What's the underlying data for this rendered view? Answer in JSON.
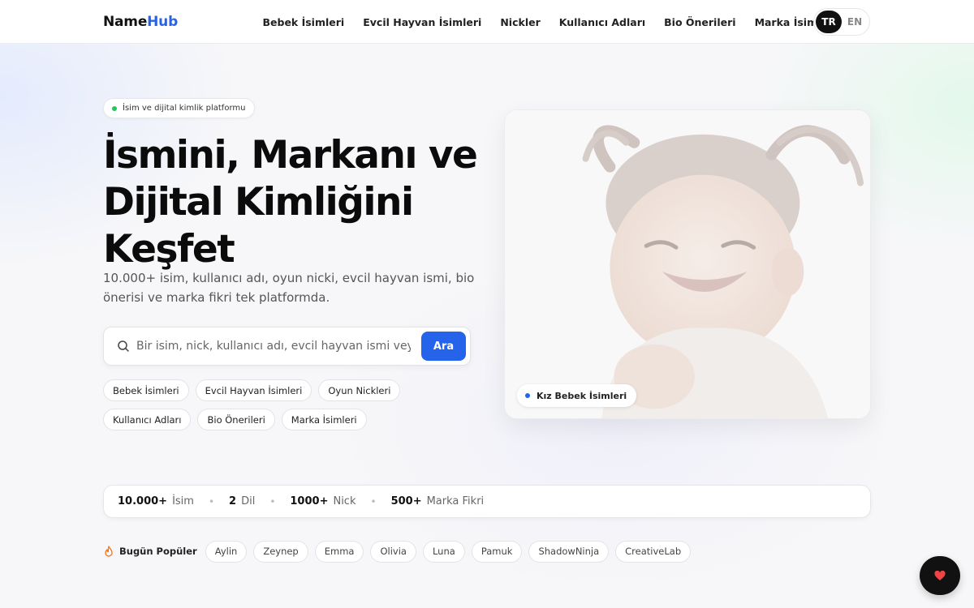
{
  "brand": {
    "name_part1": "Name",
    "name_part2": "Hub",
    "accent": "#2563eb"
  },
  "nav": {
    "items": [
      {
        "label": "Bebek İsimleri"
      },
      {
        "label": "Evcil Hayvan İsimleri"
      },
      {
        "label": "Nickler"
      },
      {
        "label": "Kullanıcı Adları"
      },
      {
        "label": "Bio Önerileri"
      },
      {
        "label": "Marka İsimleri"
      }
    ]
  },
  "lang": {
    "active": "TR",
    "other": "EN"
  },
  "hero": {
    "tag": "İsim ve dijital kimlik platformu",
    "title": "İsmini, Markanı ve Dijital Kimliğini Keşfet",
    "subtitle": "10.000+ isim, kullanıcı adı, oyun nicki, evcil hayvan ismi, bio önerisi ve marka fikri tek platformda."
  },
  "search": {
    "placeholder": "Bir isim, nick, kullanıcı adı, evcil hayvan ismi veya marka ara...",
    "button": "Ara"
  },
  "categories": [
    {
      "label": "Bebek İsimleri"
    },
    {
      "label": "Evcil Hayvan İsimleri"
    },
    {
      "label": "Oyun Nickleri"
    },
    {
      "label": "Kullanıcı Adları"
    },
    {
      "label": "Bio Önerileri"
    },
    {
      "label": "Marka İsimleri"
    }
  ],
  "hero_card": {
    "label": "Kız Bebek İsimleri",
    "image": "smiling-baby-girl-photo"
  },
  "stats": [
    {
      "num": "10.000+",
      "label": "İsim"
    },
    {
      "num": "2",
      "label": "Dil"
    },
    {
      "num": "1000+",
      "label": "Nick"
    },
    {
      "num": "500+",
      "label": "Marka Fikri"
    }
  ],
  "popular": {
    "label": "Bugün Popüler",
    "icon": "fire-icon",
    "items": [
      "Aylin",
      "Zeynep",
      "Emma",
      "Olivia",
      "Luna",
      "Pamuk",
      "ShadowNinja",
      "CreativeLab"
    ]
  },
  "fab": {
    "icon": "heart-icon",
    "color": "#ef4444"
  }
}
